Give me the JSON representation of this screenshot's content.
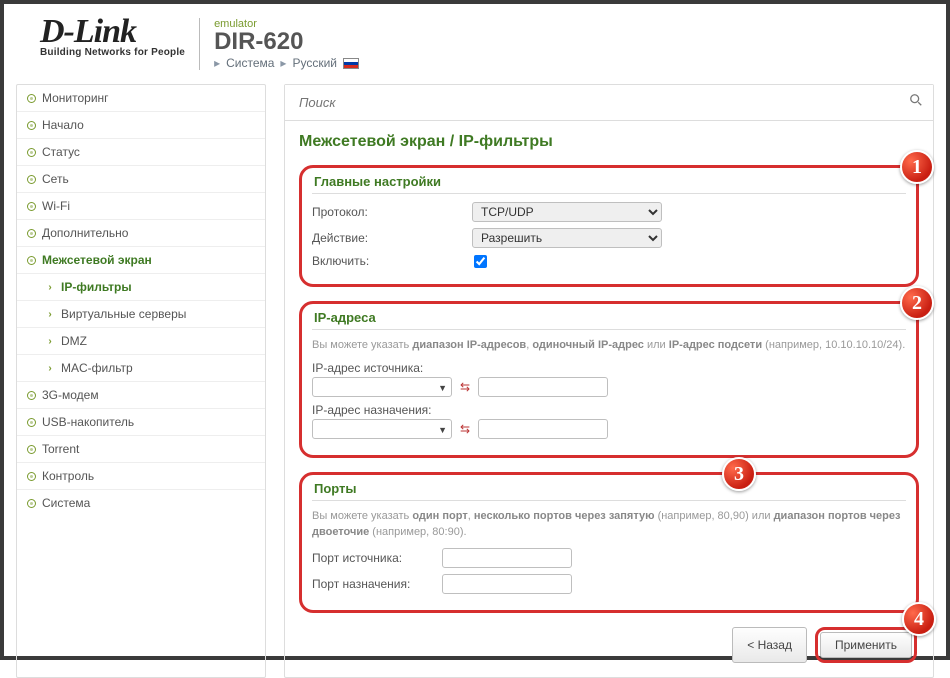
{
  "header": {
    "brand": "D-Link",
    "brand_sub": "Building Networks for People",
    "emulator": "emulator",
    "model": "DIR-620",
    "crumb_system": "Система",
    "crumb_lang": "Русский"
  },
  "search": {
    "placeholder": "Поиск"
  },
  "sidebar": {
    "items": [
      {
        "label": "Мониторинг"
      },
      {
        "label": "Начало"
      },
      {
        "label": "Статус"
      },
      {
        "label": "Сеть"
      },
      {
        "label": "Wi-Fi"
      },
      {
        "label": "Дополнительно"
      },
      {
        "label": "Межсетевой экран"
      },
      {
        "label": "IP-фильтры"
      },
      {
        "label": "Виртуальные серверы"
      },
      {
        "label": "DMZ"
      },
      {
        "label": "MAC-фильтр"
      },
      {
        "label": "3G-модем"
      },
      {
        "label": "USB-накопитель"
      },
      {
        "label": "Torrent"
      },
      {
        "label": "Контроль"
      },
      {
        "label": "Система"
      }
    ]
  },
  "page": {
    "title": "Межсетевой экран /  IP-фильтры",
    "s1": {
      "heading": "Главные настройки",
      "protocol_label": "Протокол:",
      "protocol_value": "TCP/UDP",
      "action_label": "Действие:",
      "action_value": "Разрешить",
      "enable_label": "Включить:",
      "enable_checked": true
    },
    "s2": {
      "heading": "IP-адреса",
      "hint_pre": "Вы можете указать ",
      "hint_b1": "диапазон IP-адресов",
      "hint_mid1": ", ",
      "hint_b2": "одиночный IP-адрес",
      "hint_mid2": " или ",
      "hint_b3": "IP-адрес подсети",
      "hint_post": " (например, 10.10.10.10/24).",
      "src_label": "IP-адрес источника:",
      "dst_label": "IP-адрес назначения:"
    },
    "s3": {
      "heading": "Порты",
      "hint_pre": "Вы можете указать ",
      "hint_b1": "один порт",
      "hint_mid1": ", ",
      "hint_b2": "несколько портов через запятую",
      "hint_mid2": " (например, 80,90) или ",
      "hint_b3": "диапазон портов через двоеточие",
      "hint_post": " (например, 80:90).",
      "src_label": "Порт источника:",
      "dst_label": "Порт назначения:"
    },
    "buttons": {
      "back": "< Назад",
      "apply": "Применить"
    }
  },
  "badges": [
    "1",
    "2",
    "3",
    "4"
  ]
}
